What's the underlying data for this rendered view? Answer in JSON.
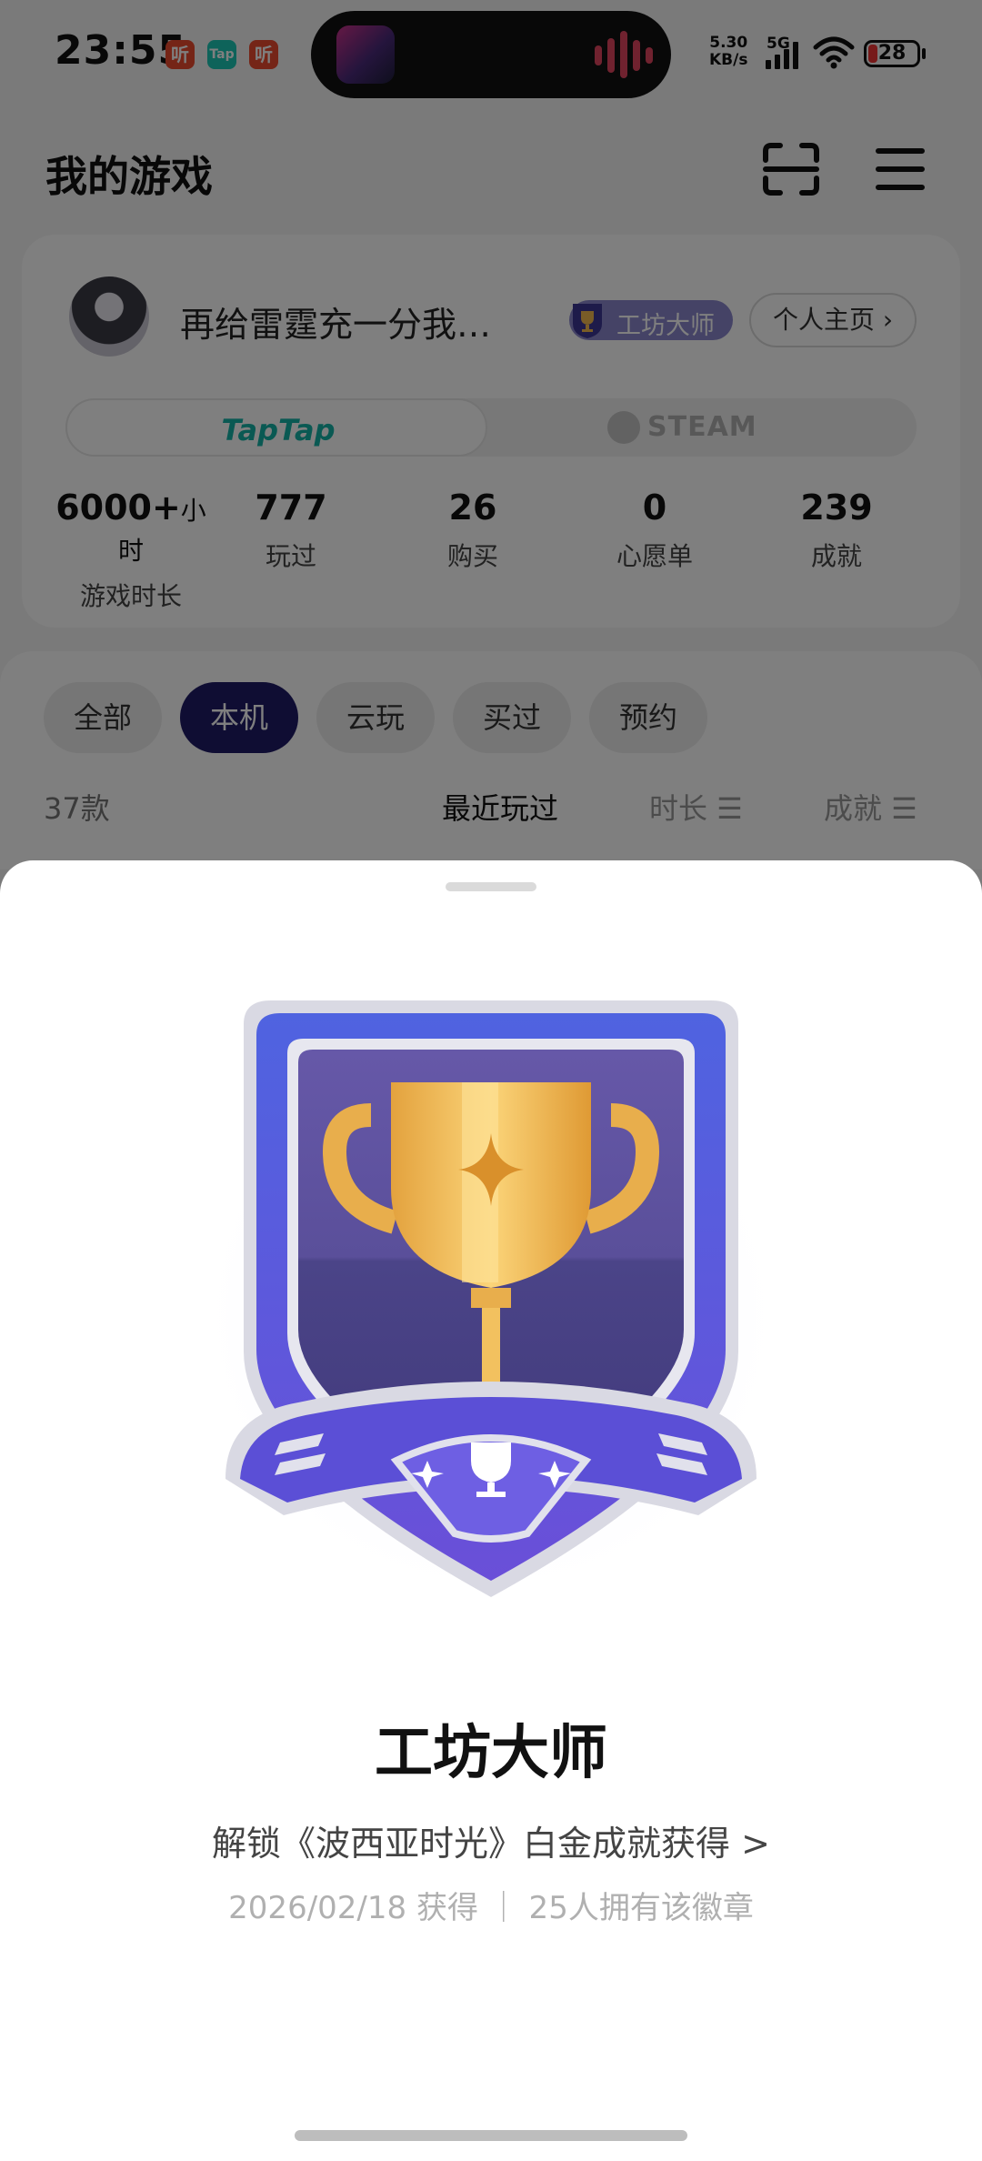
{
  "status_bar": {
    "time": "23:55",
    "notification_icons": [
      {
        "name": "listen-app-icon",
        "text": "听",
        "color": "#ea4a2e"
      },
      {
        "name": "taptap-app-icon",
        "text": "Tap",
        "color": "#1cc7b5"
      },
      {
        "name": "listen-app-icon",
        "text": "听",
        "color": "#ea4a2e"
      }
    ],
    "net_speed": "5.30",
    "net_unit": "KB/s",
    "network_type": "5G",
    "battery": "28"
  },
  "header": {
    "title": "我的游戏",
    "scan_icon": "scan-icon",
    "menu_icon": "menu-icon"
  },
  "profile": {
    "name": "再给雷霆充一分我…",
    "badge_chip_label": "工坊大师",
    "home_link": "个人主页 ›",
    "platform_tabs": [
      "TapTap",
      "STEAM"
    ],
    "stats": [
      {
        "value": "6000+",
        "unit": "小时",
        "label": "游戏时长"
      },
      {
        "value": "777",
        "unit": "",
        "label": "玩过"
      },
      {
        "value": "26",
        "unit": "",
        "label": "购买"
      },
      {
        "value": "0",
        "unit": "",
        "label": "心愿单"
      },
      {
        "value": "239",
        "unit": "",
        "label": "成就"
      }
    ]
  },
  "filters": {
    "chips": [
      "全部",
      "本机",
      "云玩",
      "买过",
      "预约"
    ],
    "active_chip": "本机",
    "count": "37款",
    "sort": [
      "最近玩过",
      "时长 ☰",
      "成就 ☰"
    ]
  },
  "sheet": {
    "badge_title": "工坊大师",
    "badge_description": "解锁《波西亚时光》白金成就获得 >",
    "badge_meta": "2026/02/18 获得 ｜ 25人拥有该徽章"
  },
  "colors": {
    "accent": "#1e1a66",
    "taptap": "#15b2a6",
    "badge_purple": "#5b4fd6",
    "trophy_gold": "#f2b94f"
  }
}
